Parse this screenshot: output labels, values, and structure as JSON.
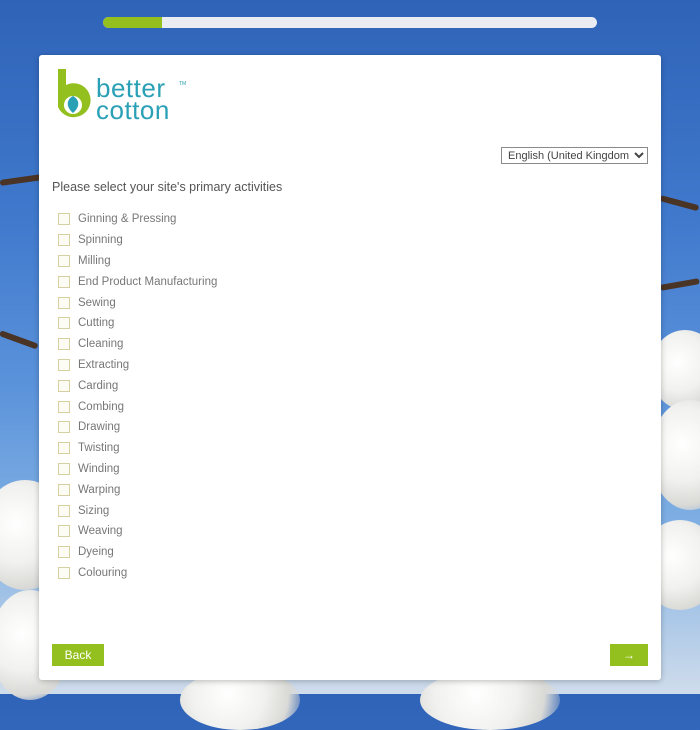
{
  "progress": {
    "fraction": 0.12
  },
  "brand": {
    "line1": "better",
    "line2": "cotton",
    "tm": "TM"
  },
  "language": {
    "selected": "English (United Kingdom)",
    "options": [
      "English (United Kingdom)"
    ]
  },
  "form": {
    "prompt": "Please select your site's primary activities",
    "activities": [
      "Ginning & Pressing",
      "Spinning",
      "Milling",
      "End Product Manufacturing",
      "Sewing",
      "Cutting",
      "Cleaning",
      "Extracting",
      "Carding",
      "Combing",
      "Drawing",
      "Twisting",
      "Winding",
      "Warping",
      "Sizing",
      "Weaving",
      "Dyeing",
      "Colouring"
    ]
  },
  "nav": {
    "back_label": "Back",
    "next_label": "→"
  },
  "colors": {
    "accent": "#93c01f",
    "brand_teal": "#2aa0b6",
    "sky": "#3f78cc"
  }
}
